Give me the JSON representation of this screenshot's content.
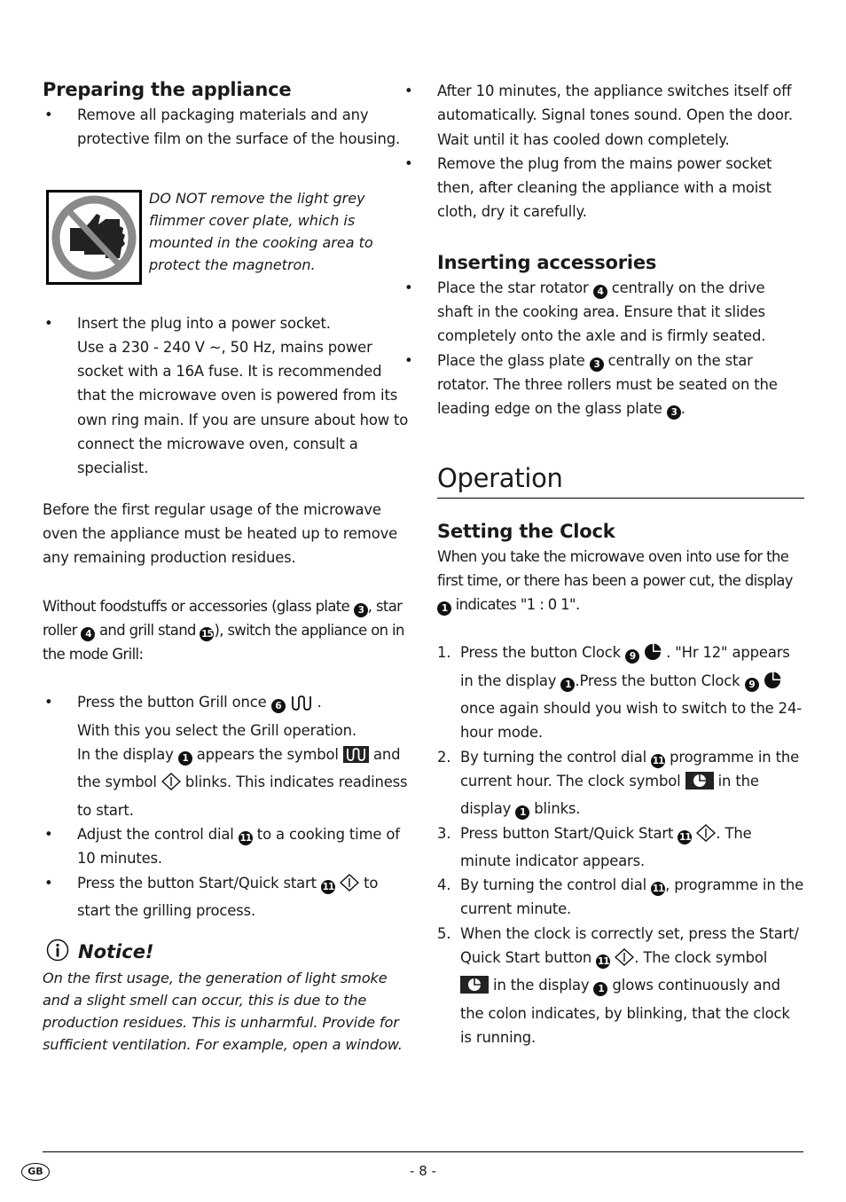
{
  "left": {
    "preparing": {
      "heading": "Preparing the appliance",
      "bullet1": "Remove all packaging materials and any protective film on the surface of the housing."
    },
    "warning": {
      "icon": "no-touching-prohibition-icon",
      "strong": "DO NOT",
      "text": " remove the light grey flimmer cover plate, which is mounted in the cooking area to protect the magnetron."
    },
    "plug": {
      "line1": "Insert the plug into a power socket.",
      "line2": "Use a 230 - 240 V ~, 50 Hz, mains power socket with a 16A fuse. It is recommended that the microwave oven is powered from its own ring main. If you are unsure about how to connect the microwave oven, consult a specialist."
    },
    "before_first_use": "Before the first regular usage of the microwave oven the appliance must be heated up to remove any remaining production residues.",
    "without": {
      "p1": "Without foodstuffs or accessories (glass plate ",
      "ref1": "3",
      "p2": ", star roller ",
      "ref2": "4",
      "p3": " and grill stand ",
      "ref3": "15",
      "p4": "), switch the appliance on in the mode Grill:"
    },
    "grill_steps": {
      "s1a": "Press the button Grill once ",
      "s1ref": "6",
      "s1b": " .",
      "s1c": "With this you select the Grill operation.",
      "s1d": "In the display ",
      "s1dref": "1",
      "s1e": " appears the symbol ",
      "s1f": " and the symbol ",
      "s1g": " blinks. This indicates readiness to start.",
      "s2a": "Adjust the control dial ",
      "s2ref": "11",
      "s2b": " to a cooking time of 10 minutes.",
      "s3a": "Press the button Start/Quick start ",
      "s3ref": "11",
      "s3b": " to start the grilling process."
    },
    "notice": {
      "title": "Notice!",
      "text": "On the first usage, the generation of light smoke and a slight smell can occur, this is due to the production residues. This is unharmful. Provide for sufficient ventilation. For example, open a window."
    }
  },
  "right": {
    "after": {
      "b1": "After 10 minutes, the appliance switches itself off automatically. Signal tones sound. Open the door. Wait until it has cooled down completely.",
      "b2": "Remove the plug from the mains power socket then, after cleaning the appliance with a moist cloth, dry it carefully."
    },
    "accessories": {
      "heading": "Inserting accessories",
      "b1a": "Place the star rotator ",
      "b1ref": "4",
      "b1b": " centrally on the drive shaft in the cooking area. Ensure that it slides completely onto the axle and is firmly seated.",
      "b2a": "Place the glass plate ",
      "b2ref": "3",
      "b2b": " centrally on the star rotator. The three rollers must be seated on the leading edge on the glass plate ",
      "b2ref2": "3",
      "b2c": "."
    },
    "operation": {
      "heading": "Operation",
      "clock_heading": "Setting the Clock",
      "intro_a": "When you take the microwave oven into use for the first time, or there has been a power cut, the display ",
      "intro_ref": "1",
      "intro_b": " indicates \"1 : 0 1\".",
      "steps": [
        {
          "n": "1.",
          "a": "Press the button Clock ",
          "ref": "9",
          "b": " . \"Hr 12\" appears in the display ",
          "ref2": "1",
          "c": ".Press the button Clock ",
          "ref3": "9",
          "d": " once again should you wish to switch to the 24-hour mode."
        },
        {
          "n": "2.",
          "a": "By turning the control dial ",
          "ref": "11",
          "b": " programme in the current hour. The clock symbol ",
          "c": " in the display ",
          "ref2": "1",
          "d": " blinks."
        },
        {
          "n": "3.",
          "a": "Press button Start/Quick Start ",
          "ref": "11",
          "b": ". The minute indicator appears."
        },
        {
          "n": "4.",
          "a": "By turning the control dial ",
          "ref": "11",
          "b": ", programme in the current minute."
        },
        {
          "n": "5.",
          "a": "When the clock is correctly set, press the Start/ Quick Start button ",
          "ref": "11",
          "b": ". The clock symbol ",
          "c": " in the display ",
          "ref2": "1",
          "d": " glows continuously and the colon indicates, by blinking, that the clock is running."
        }
      ]
    }
  },
  "footer": {
    "country": "GB",
    "page": "- 8 -"
  }
}
